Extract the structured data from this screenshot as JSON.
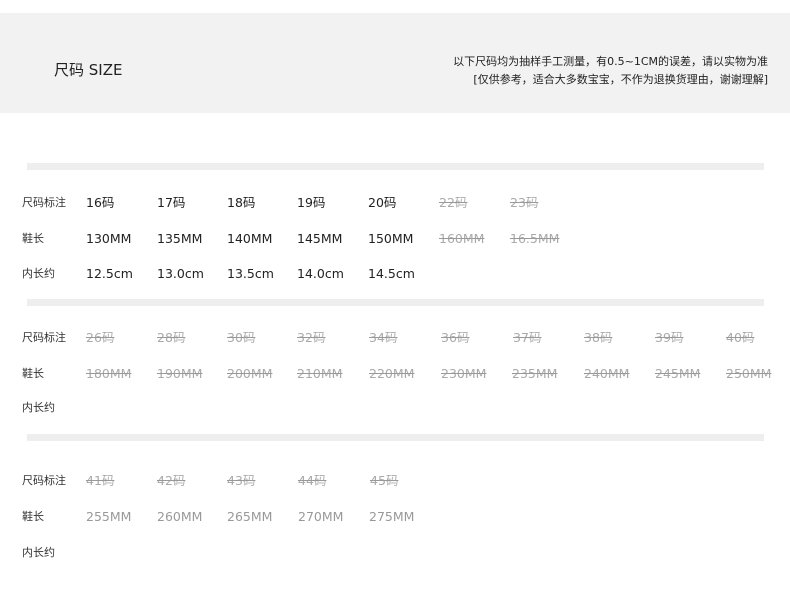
{
  "header": {
    "title": "尺码 SIZE",
    "note_line1": "以下尺码均为抽样手工测量，有0.5~1CM的误差，请以实物为准",
    "note_line2": "[仅供参考，适合大多数宝宝，不作为退换货理由，谢谢理解]"
  },
  "table1": {
    "size_label": "尺码标注",
    "length_label": "鞋长",
    "inner_label": "内长约",
    "sizes": [
      "16码",
      "17码",
      "18码",
      "19码",
      "20码",
      "22码",
      "23码"
    ],
    "lengths": [
      "130MM",
      "135MM",
      "140MM",
      "145MM",
      "150MM",
      "160MM",
      "16.5MM"
    ],
    "inner": [
      "12.5cm",
      "13.0cm",
      "13.5cm",
      "14.0cm",
      "14.5cm"
    ]
  },
  "table2": {
    "size_label": "尺码标注",
    "length_label": "鞋长",
    "inner_label": "内长约",
    "sizes": [
      "26码",
      "28码",
      "30码",
      "32码",
      "34码",
      "36码",
      "37码",
      "38码",
      "39码",
      "40码"
    ],
    "lengths": [
      "180MM",
      "190MM",
      "200MM",
      "210MM",
      "220MM",
      "230MM",
      "235MM",
      "240MM",
      "245MM",
      "250MM"
    ]
  },
  "table3": {
    "size_label": "尺码标注",
    "length_label": "鞋长",
    "inner_label": "内长约",
    "sizes": [
      "41码",
      "42码",
      "43码",
      "44码",
      "45码"
    ],
    "lengths": [
      "255MM",
      "260MM",
      "265MM",
      "270MM",
      "275MM"
    ]
  }
}
